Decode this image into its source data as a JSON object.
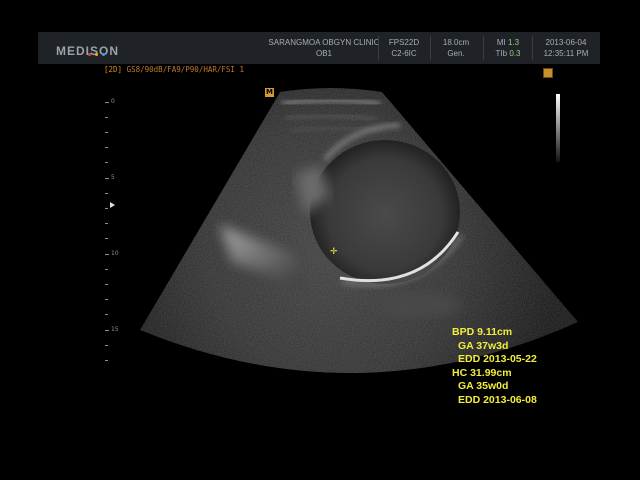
{
  "header": {
    "brand": "MEDISON",
    "brand_dot_colors": [
      "#e3423a",
      "#f0b400",
      "#3aa0e0"
    ],
    "clinic_name": "SARANGMOA OBGYN CLINIC",
    "preset": "OB1",
    "fps": "FPS22D",
    "probe": "C2-6IC",
    "depth": "18.0cm",
    "freq_mode": "Gen.",
    "mi_label": "MI",
    "mi_value": "1.3",
    "tib_label": "TIb",
    "tib_value": "0.3",
    "date": "2013-06-04",
    "time": "12:35:11 PM"
  },
  "mode_line": {
    "mode": "[2D]",
    "params": "GS8/90dB/FA9/P90/HAR/FSI 1"
  },
  "markers": {
    "orientation_marker": "M"
  },
  "depth_scale": {
    "labels": [
      "0",
      "5",
      "10",
      "15"
    ]
  },
  "measurements": {
    "bpd_label": "BPD",
    "bpd_value": "9.11cm",
    "bpd_ga_label": "GA",
    "bpd_ga_value": "37w3d",
    "bpd_edd_label": "EDD",
    "bpd_edd_value": "2013-05-22",
    "hc_label": "HC",
    "hc_value": "31.99cm",
    "hc_ga_label": "GA",
    "hc_ga_value": "35w0d",
    "hc_edd_label": "EDD",
    "hc_edd_value": "2013-06-08"
  },
  "colors": {
    "measurement_text": "#f2ee3c",
    "mode_text": "#c07a2a",
    "header_bg": "#1f2226"
  }
}
